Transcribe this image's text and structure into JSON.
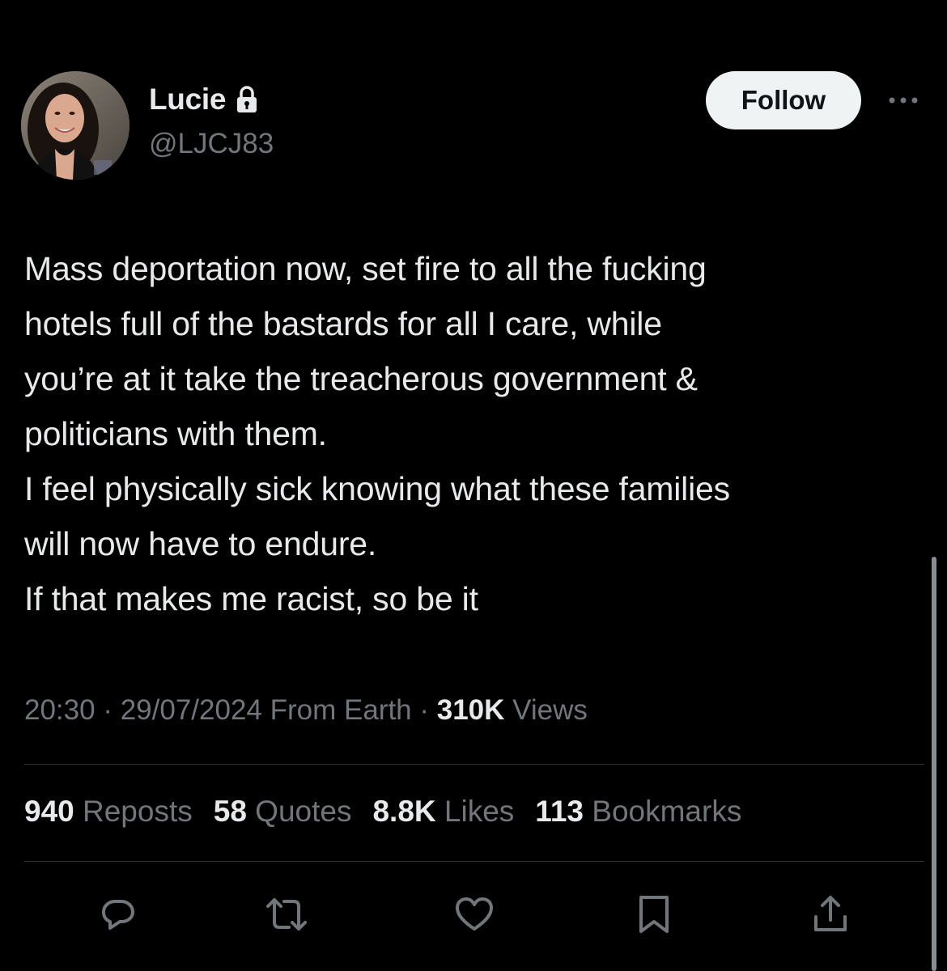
{
  "author": {
    "display_name": "Lucie",
    "handle": "@LJCJ83",
    "avatar_icon": "profile-photo",
    "protected_icon": "lock-icon"
  },
  "follow_label": "Follow",
  "more_icon": "more-dots-icon",
  "tweet": {
    "text": "Mass deportation now, set fire to all the fucking\nhotels full of the bastards for all I care, while\nyou’re at it take the treacherous government &\npoliticians with them.\nI feel physically sick knowing what these families\nwill now have to endure.\nIf that makes me racist, so be it"
  },
  "meta": {
    "time": "20:30",
    "separator": " · ",
    "date": "29/07/2024",
    "source": " From Earth",
    "views_count": "310K",
    "views_label": " Views"
  },
  "stats": {
    "reposts_count": "940",
    "reposts_label": " Reposts",
    "quotes_count": "58",
    "quotes_label": " Quotes",
    "likes_count": "8.8K",
    "likes_label": " Likes",
    "bookmarks_count": "113",
    "bookmarks_label": " Bookmarks"
  },
  "actions": [
    "reply-icon",
    "repost-icon",
    "like-icon",
    "bookmark-icon",
    "share-icon"
  ],
  "colors": {
    "background": "#000000",
    "primary_text": "#e7e9ea",
    "secondary_text": "#71767b",
    "divider": "#2f3336",
    "follow_button_bg": "#eff3f4"
  }
}
